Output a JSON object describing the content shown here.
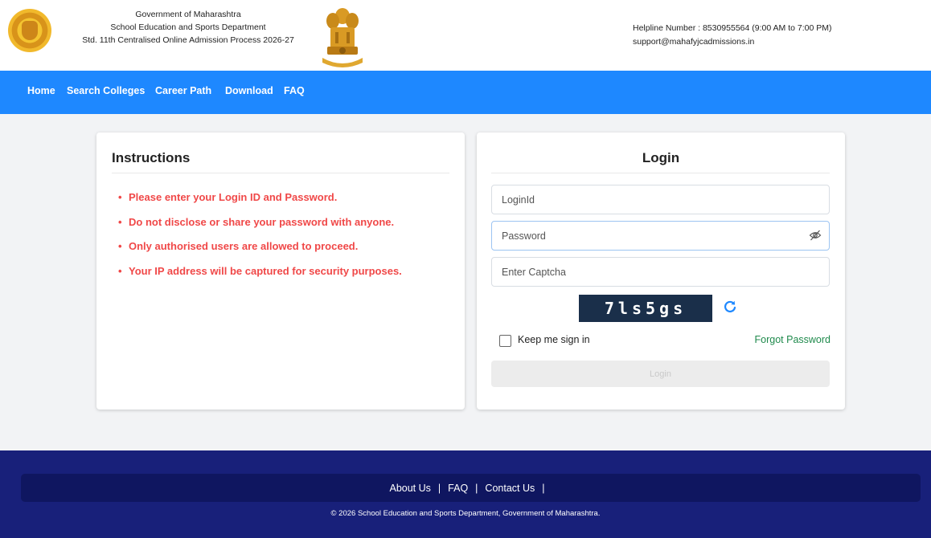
{
  "header": {
    "line1": "Government of Maharashtra",
    "line2": "School Education and Sports Department",
    "line3": "Std. 11th Centralised Online Admission Process 2026-27",
    "helpline": "Helpline Number : 8530955564 (9:00 AM to 7:00 PM)",
    "email": "support@mahafyjcadmissions.in",
    "left_logo_icon": "maharashtra-seal-icon",
    "right_logo_icon": "national-emblem-icon"
  },
  "nav": {
    "items": [
      {
        "label": "Home"
      },
      {
        "label": "Search Colleges"
      },
      {
        "label": "Career Path"
      },
      {
        "label": "Download"
      },
      {
        "label": "FAQ"
      }
    ]
  },
  "instructions": {
    "title": "Instructions",
    "items": [
      "Please enter your Login ID and Password.",
      "Do not disclose or share your password with anyone.",
      "Only authorised users are allowed to proceed.",
      "Your IP address will be captured for security purposes."
    ]
  },
  "login": {
    "title": "Login",
    "loginid_placeholder": "LoginId",
    "password_placeholder": "Password",
    "captcha_placeholder": "Enter Captcha",
    "captcha_text": "7ls5gs",
    "keep_signed_in_label": "Keep me sign in",
    "forgot_password_label": "Forgot Password",
    "submit_label": "Login",
    "eye_icon": "eye-slash-icon",
    "refresh_icon": "refresh-icon"
  },
  "footer": {
    "links": [
      {
        "label": "About Us"
      },
      {
        "label": "FAQ"
      },
      {
        "label": "Contact Us"
      }
    ],
    "separator": "|",
    "copyright": "© 2026 School Education and Sports Department, Government of Maharashtra."
  },
  "colors": {
    "nav_bg": "#1e88ff",
    "instruction_text": "#f04848",
    "forgot_link": "#1f8a4c",
    "footer_bg": "#18207a",
    "captcha_bg": "#1a2f4a"
  }
}
